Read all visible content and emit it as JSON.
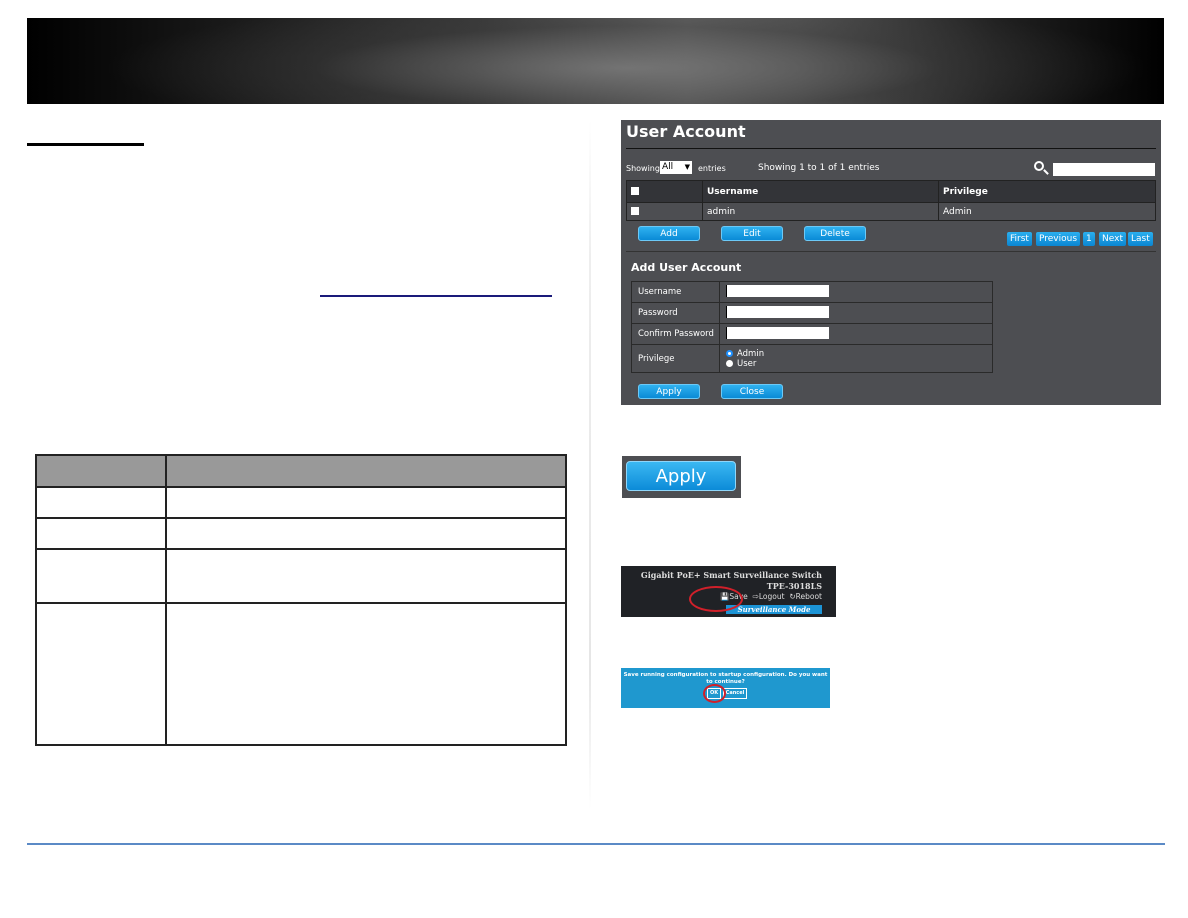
{
  "document": {
    "colors": {
      "footer_rule": "#5b8ac6",
      "accent_button": "#0a8ad6",
      "panel_bg": "#4d4e52",
      "highlight_ring": "#d0202a"
    },
    "param_table": {
      "rows": 5
    }
  },
  "user_account": {
    "title": "User Account",
    "showing_label": "Showing",
    "showing_value": "All",
    "entries_label": "entries",
    "showing_info": "Showing 1 to 1 of 1 entries",
    "search_placeholder": "",
    "columns": [
      "",
      "Username",
      "Privilege"
    ],
    "rows": [
      {
        "username": "admin",
        "privilege": "Admin"
      }
    ],
    "buttons": {
      "add": "Add",
      "edit": "Edit",
      "delete": "Delete"
    },
    "pagination": {
      "first": "First",
      "previous": "Previous",
      "page": "1",
      "next": "Next",
      "last": "Last"
    }
  },
  "add_user": {
    "title": "Add User Account",
    "username_label": "Username",
    "password_label": "Password",
    "confirm_label": "Confirm Password",
    "privilege_label": "Privilege",
    "privilege_options": [
      "Admin",
      "User"
    ],
    "privilege_selected": "Admin",
    "apply": "Apply",
    "close": "Close"
  },
  "apply_callout": {
    "label": "Apply"
  },
  "switch_header": {
    "product_line": "Gigabit PoE+ Smart Surveillance Switch",
    "model": "TPE-3018LS",
    "save": "Save",
    "logout": "Logout",
    "reboot": "Reboot",
    "mode": "Surveillance Mode"
  },
  "save_dialog": {
    "message": "Save running configuration to startup configuration. Do you want to continue?",
    "ok": "OK",
    "cancel": "Cancel"
  }
}
